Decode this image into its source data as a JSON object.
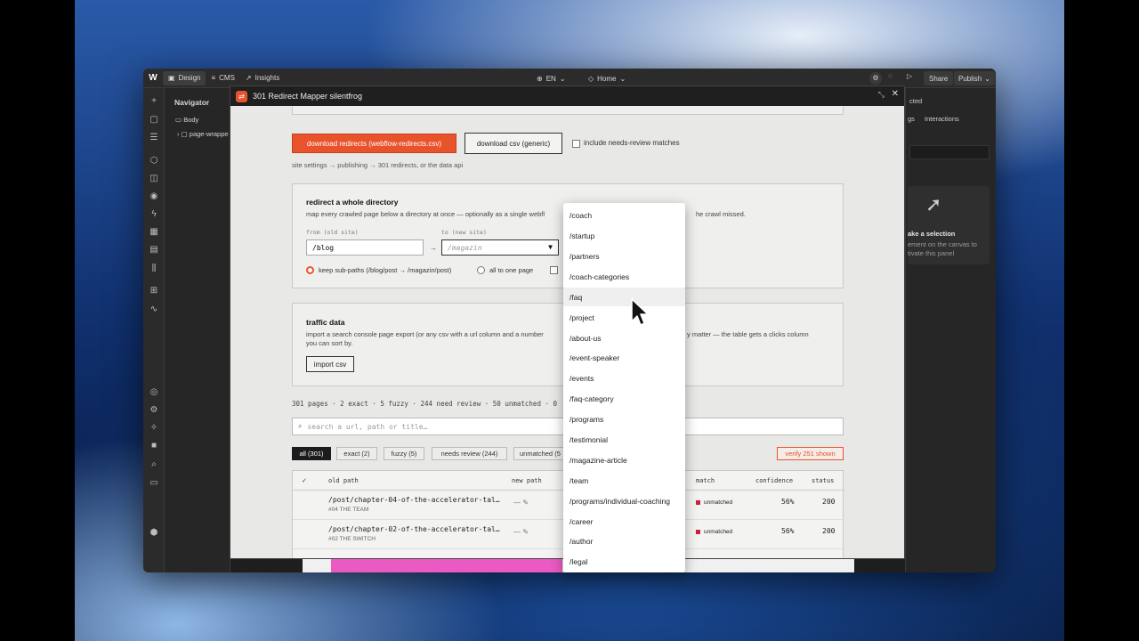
{
  "toolbar": {
    "design": "Design",
    "cms": "CMS",
    "insights": "Insights",
    "lang": "EN",
    "page": "Home",
    "share": "Share",
    "publish": "Publish"
  },
  "navigator": {
    "title": "Navigator",
    "body": "Body",
    "page_wrapper": "page-wrappe"
  },
  "right_panel": {
    "tab_partial": "gs",
    "interactions": "Interactions",
    "top_partial": "cted",
    "selection_title": "ake a selection",
    "selection_line1": "ement on the canvas to",
    "selection_line2": "tivate this panel"
  },
  "modal": {
    "title": "301 Redirect Mapper silentfrog",
    "download_webflow": "download redirects (webflow-redirects.csv)",
    "download_generic": "download csv (generic)",
    "include_review": "include needs-review matches",
    "hint": "site settings → publishing → 301 redirects, or the data api",
    "directory": {
      "title": "redirect a whole directory",
      "desc_left": "map every crawled page below a directory at once — optionally as a single webfl",
      "desc_right": "he crawl missed.",
      "from_label": "from (old site)",
      "from_value": "/blog",
      "arrow": "→",
      "to_label": "to (new site)",
      "to_placeholder": "/magazin",
      "opt_keep": "keep sub-paths (/blog/post → /magazin/post)",
      "opt_one": "all to one page"
    },
    "traffic": {
      "title": "traffic data",
      "desc_left1": "import a search console page export (or any csv with a url column and a number",
      "desc_right1": "y matter — the table gets a clicks column",
      "desc_line2": "you can sort by.",
      "import": "import csv"
    },
    "stats": "301 pages · 2 exact · 5 fuzzy · 244 need review · 50 unmatched · 0",
    "search_placeholder": "search a url, path or title…",
    "filters": [
      "all (301)",
      "exact (2)",
      "fuzzy (5)",
      "needs review (244)",
      "unmatched (5"
    ],
    "verify": "verify 251 shown",
    "columns": {
      "check": "✓",
      "old": "old path",
      "new": "new path",
      "match": "match",
      "confidence": "confidence",
      "status": "status"
    },
    "rows": [
      {
        "old": "/post/chapter-04-of-the-accelerator-tal…",
        "sub": "#04 THE TEAM",
        "new": "— ✎",
        "match": "unmatched",
        "confidence": "56%",
        "status": "200"
      },
      {
        "old": "/post/chapter-02-of-the-accelerator-tal…",
        "sub": "#02 THE SWITCH",
        "new": "— ✎",
        "match": "unmatched",
        "confidence": "56%",
        "status": "200"
      }
    ]
  },
  "dropdown": [
    "/coach",
    "/startup",
    "/partners",
    "/coach-categories",
    "/faq",
    "/project",
    "/about-us",
    "/event-speaker",
    "/events",
    "/faq-category",
    "/programs",
    "/testimonial",
    "/magazine-article",
    "/team",
    "/programs/individual-coaching",
    "/career",
    "/author",
    "/legal"
  ],
  "colors": {
    "accent": "#e8532c",
    "unmatched": "#d01f3c"
  }
}
